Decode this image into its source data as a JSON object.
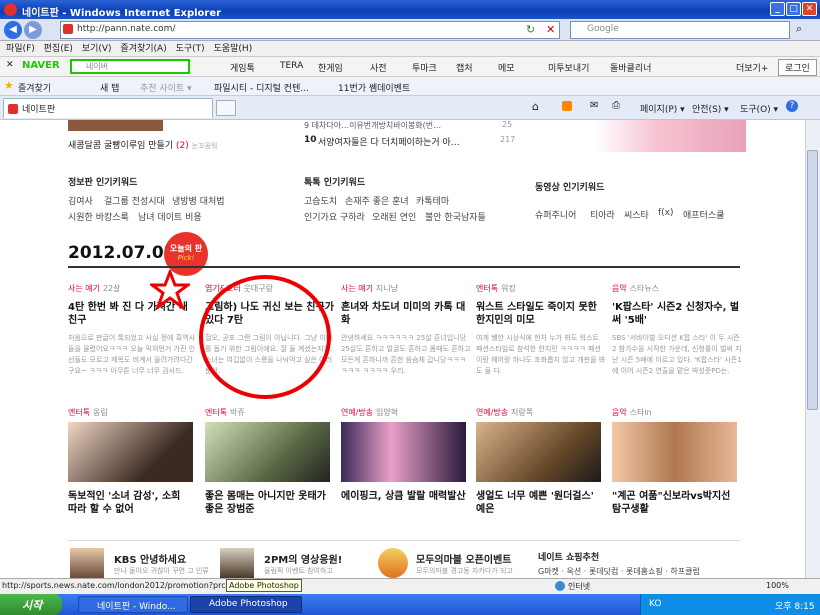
{
  "window": {
    "title": "네이트판 - Windows Internet Explorer"
  },
  "address": {
    "url": "http://pann.nate.com/",
    "search_placeholder": "Google"
  },
  "menu": [
    "파일(F)",
    "편집(E)",
    "보기(V)",
    "즐겨찾기(A)",
    "도구(T)",
    "도움말(H)"
  ],
  "naver": {
    "brand": "NAVER",
    "search_placeholder": "네이버",
    "items": [
      "게임톡",
      "TERA",
      "한게임",
      "사전",
      "투마크",
      "캡처",
      "메모",
      "미투보내기",
      "돌바클리너"
    ],
    "more": "더보기+",
    "login": "로그인"
  },
  "fav": {
    "label": "즐겨찾기",
    "items": [
      "새 탭",
      "추천 사이트 ▾",
      "파일시티 - 디지털 컨텐...",
      "11번가 쎔데이벤트"
    ]
  },
  "tab": {
    "label": "네이트판"
  },
  "cmd": {
    "page": "페이지(P) ▾",
    "safety": "안전(S) ▾",
    "tools": "도구(O) ▾",
    "help": "?"
  },
  "top_left": {
    "item1": "새콤달콤 굴빵이루임 만들기",
    "item1_count": "(2)",
    "item1_tag": "눈꼬꿈워"
  },
  "top_mid": {
    "item_a": "9 데차다아…이유번개방치바이봉화(번…",
    "num_b": "10",
    "item_b": "서양여자들은 다 더치페이하는거 아…",
    "count_a": "25",
    "count_b": "217"
  },
  "keywords": {
    "col1": {
      "title": "정보판 인기키워드",
      "rows": [
        [
          "김여사",
          "걸그룹 전성시대",
          "냉방병 대처법"
        ],
        [
          "시원한 바캉스룩",
          "남녀 데이트 비용"
        ]
      ]
    },
    "col2": {
      "title": "톡톡 인기키워드",
      "rows": [
        [
          "고슴도치",
          "손재주 좋은 훈녀",
          "카톡테마"
        ],
        [
          "인기가요 구하라",
          "오래된 연인",
          "불안 한국남자들"
        ]
      ]
    },
    "col3": {
      "title": "동영상 인기키워드",
      "rows": [
        [
          "슈퍼주니어",
          "티아라",
          "씨스타",
          "f(x)",
          "애프터스쿨"
        ]
      ]
    }
  },
  "date": "2012.07.02",
  "badge": {
    "line1": "오늘의 판",
    "line2": "Pick!"
  },
  "row1": [
    {
      "cat": "사는 얘기",
      "sub": "22살",
      "title": "4탄 한번 봐 진 다 가져간 내 친구",
      "preview": "처음으로 판글이 톡되었고 사실 정에 흑역사들을 올렸어요ㅋㅋㅋ 오늘 익혀먼거 가진 인선들도 모르고 제목도 비계서 올려가려다간구요~ ㅋㅋㅋ 아무튼 너무 너무 감사드."
    },
    {
      "cat": "엽기&호러",
      "sub": "웃대구랑",
      "title": "그림하) 나도 귀신 보는 친구가 있다 7탄",
      "preview": "헐오, 공포 그랜 그림이 아닙니다. 그냥 이해를 돕기 위한 그림이에요. 잘 들 계셨는지요. 소녀는 여깁없이 스릉을 나눠먹고 싶은 여러분이."
    },
    {
      "cat": "사는 얘기",
      "sub": "지니냥",
      "title": "흔녀와 차도녀 미미의 카톡 대화",
      "preview": "안녕하세요 ㅋㅋㅋㅋㅋㅋ 25살 흔녀입니당 25살도 흔하고 얼굴도 흔하고 몸매도 흔하고 모든게 흔하니까 흔한 음슴체 갑니당ㅋㅋㅋㅋㅋㅋ ㅋㅋㅋㅋ 우리."
    },
    {
      "cat": "엔터톡",
      "sub": "워킹",
      "title": "워스트 스타일도 죽이지 못한 한지민의 미모",
      "preview": "여게 웰한 시상식에 한차 누가 봐도 워스트 패션스타일로 참석한 한지민 ㅋㅋㅋㅋ 패션이랑 헤어랑 하나도 조화롭지 않고 개판을 봐도 들 다."
    },
    {
      "cat": "음악",
      "sub": "스타뉴스",
      "title": "'K팝스타' 시즌2 신청자수, 벌써 '5배'",
      "preview": "SBS '서바이벌 오디션 K팝 스타' 이 두 시즌2 참가수을 시작한 가운데, 신청률이 벌써 지난 시즌 5배에 이르고 있다. 'K팝스타' 시즌1에 이어 시즌2 연출을 맡은 박성준PD는."
    }
  ],
  "row2": [
    {
      "cat": "엔터톡",
      "sub": "옹림",
      "title": "독보적인 '소녀 감성', 소희 따라 할 수 없어"
    },
    {
      "cat": "엔터톡",
      "sub": "박쥬",
      "title": "좋은 몸매는 아니지만 옷태가 좋은 장범준"
    },
    {
      "cat": "연예/방송",
      "sub": "임양혁",
      "title": "에이핑크, 상큼 발랄 매력발산"
    },
    {
      "cat": "연예/방송",
      "sub": "지랑쪽",
      "title": "생얼도 너무 예쁜 '원더걸스' 예은"
    },
    {
      "cat": "음악",
      "sub": "스타in",
      "title": "\"계곤 여품\"신보라vs박지선 탐구생활"
    }
  ],
  "bottom": {
    "b1": "KBS 안녕하세요",
    "b1_sub": "만나 돌아오 귀찮아 꾸면 고 인류",
    "b2": "2PM의 영상응원!",
    "b2_sub": "올림픽 이벤트 참여하고",
    "b3": "모두의마블 오픈이벤트",
    "b3_sub": "모두의마블 경고동 자카다가 되고",
    "shop_title": "네이트 쇼핑추천",
    "shop": "G마켓 · 옥션 · 롯데닷컴 · 롯데홈쇼핑 · 하프클럽"
  },
  "status": {
    "url": "http://sports.news.nate.com/london2012/promotion?prc",
    "tooltip": "Adobe Photoshop",
    "zone": "인터넷",
    "zoom": "100%"
  },
  "taskbar": {
    "start": "시작",
    "t1": "네이트판 - Windo...",
    "t2": "Adobe Photoshop",
    "lang": "KO",
    "time": "오후 8:15"
  }
}
